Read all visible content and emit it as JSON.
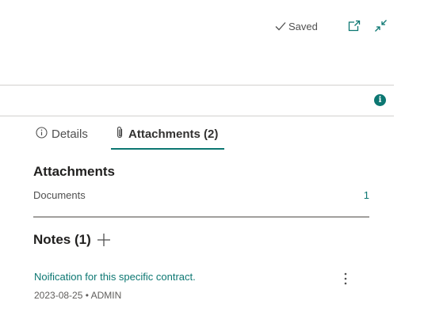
{
  "header": {
    "saved_label": "Saved",
    "icons": {
      "saved": "checkmark-icon",
      "open_new": "open-in-new-window-icon",
      "collapse": "collapse-icon",
      "info": "info-icon"
    }
  },
  "info_badge": "i",
  "tabs": [
    {
      "label": "Details",
      "icon": "info-circle-icon",
      "active": false
    },
    {
      "label": "Attachments (2)",
      "icon": "paperclip-icon",
      "active": true
    }
  ],
  "attachments": {
    "title": "Attachments",
    "rows": [
      {
        "label": "Documents",
        "count": "1"
      }
    ]
  },
  "notes": {
    "title": "Notes (1)",
    "items": [
      {
        "text": "Noification for this specific contract.",
        "meta": "2023-08-25 • ADMIN"
      }
    ]
  },
  "colors": {
    "accent": "#0c7772",
    "text": "#323130",
    "muted": "#605e5c",
    "divider": "#d2d0ce"
  }
}
